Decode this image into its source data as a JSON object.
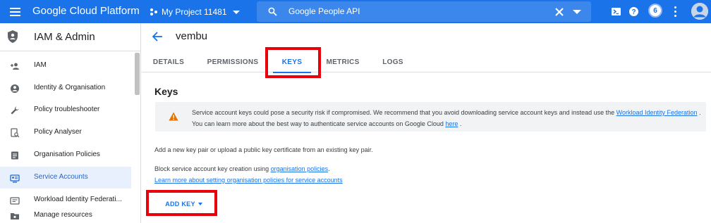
{
  "topbar": {
    "app_title": "Google Cloud Platform",
    "project_label": "My Project 11481",
    "search_value": "Google People API",
    "notification_count": "6",
    "icons": [
      "menu-icon",
      "project-dots-icon",
      "search-icon",
      "clear-icon",
      "expand-icon",
      "cloud-shell-icon",
      "help-icon",
      "more-vert-icon",
      "account-icon"
    ]
  },
  "sidebar": {
    "title": "IAM & Admin",
    "items": [
      {
        "label": "IAM",
        "icon": "person-add-icon",
        "active": false
      },
      {
        "label": "Identity & Organisation",
        "icon": "account-circle-icon",
        "active": false
      },
      {
        "label": "Policy troubleshooter",
        "icon": "wrench-icon",
        "active": false
      },
      {
        "label": "Policy Analyser",
        "icon": "analyser-icon",
        "active": false
      },
      {
        "label": "Organisation Policies",
        "icon": "list-doc-icon",
        "active": false
      },
      {
        "label": "Service Accounts",
        "icon": "service-account-icon",
        "active": true
      },
      {
        "label": "Workload Identity Federati...",
        "icon": "id-card-icon",
        "active": false
      },
      {
        "label": "Manage resources",
        "icon": "folder-icon",
        "active": false
      }
    ]
  },
  "main": {
    "title": "vembu",
    "tabs": [
      {
        "label": "DETAILS",
        "active": false
      },
      {
        "label": "PERMISSIONS",
        "active": false
      },
      {
        "label": "KEYS",
        "active": true
      },
      {
        "label": "METRICS",
        "active": false
      },
      {
        "label": "LOGS",
        "active": false
      }
    ],
    "section_heading": "Keys",
    "warning": {
      "text_before": "Service account keys could pose a security risk if compromised. We recommend that you avoid downloading service account keys and instead use the ",
      "link1": "Workload Identity Federation",
      "text_middle": " . You can learn more about the best way to authenticate service accounts on Google Cloud ",
      "link2": "here",
      "text_after": " ."
    },
    "add_key_info": "Add a new key pair or upload a public key certificate from an existing key pair.",
    "block_text": "Block service account key creation using ",
    "block_link": "organisation policies",
    "block_end": ".",
    "learn_link": "Learn more about setting organisation policies for service accounts",
    "add_key_button": "ADD KEY"
  },
  "colors": {
    "brand_blue": "#1a73e8",
    "highlight_red": "#e8000b",
    "warning_orange": "#e37400",
    "active_nav_bg": "#e8f0fe"
  }
}
